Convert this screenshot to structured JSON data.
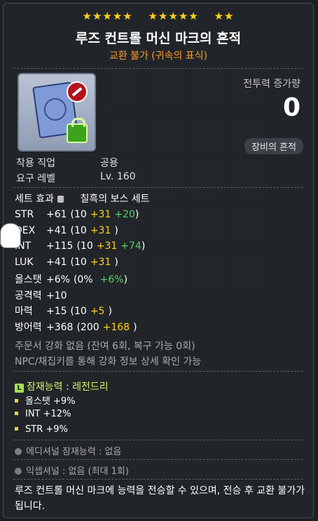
{
  "stars": {
    "group1": "★★★★★",
    "group2": "★★★★★",
    "group3": "★★"
  },
  "item": {
    "name": "루즈 컨트롤 머신 마크의 흔적",
    "trade": "교환 불가 (귀속의 표식)",
    "combat_power_label": "전투력 증가량",
    "combat_power_value": "0",
    "trace_button": "장비의 흔적"
  },
  "requirements": {
    "job_label": "착용 직업",
    "job_value": "공용",
    "level_label": "요구 레벨",
    "level_value": "Lv. 160"
  },
  "set_effect": {
    "label": "세트 효과",
    "value": "칠흑의 보스 세트"
  },
  "stats": [
    {
      "k": "STR",
      "total": "+61",
      "base": "(10",
      "plus1": "+31",
      "plus2": "+20",
      "close": ")"
    },
    {
      "k": "DEX",
      "total": "+41",
      "base": "(10",
      "plus1": "+31",
      "plus2": "",
      "close": ")"
    },
    {
      "k": "INT",
      "total": "+115",
      "base": "(10",
      "plus1": "+31",
      "plus2": "+74",
      "close": ")"
    },
    {
      "k": "LUK",
      "total": "+41",
      "base": "(10",
      "plus1": "+31",
      "plus2": "",
      "close": ")"
    },
    {
      "k": "올스탯",
      "total": "+6%",
      "base": "(0%",
      "plus1": "",
      "plus2": "+6%",
      "close": ")"
    },
    {
      "k": "공격력",
      "total": "+10",
      "base": "",
      "plus1": "",
      "plus2": "",
      "close": ""
    },
    {
      "k": "마력",
      "total": "+15",
      "base": "(10",
      "plus1": "+5",
      "plus2": "",
      "close": ")"
    },
    {
      "k": "방어력",
      "total": "+368",
      "base": "(200",
      "plus1": "+168",
      "plus2": "",
      "close": ")"
    }
  ],
  "scroll_info": "주문서 강화 없음 (잔여 6회, 복구 가능 0회)",
  "npc_info": "NPC/채집키를 통해 강화 정보 상세 확인 가능",
  "potential": {
    "badge": "L",
    "title": "잠재능력 : 레전드리",
    "lines": [
      "올스탯 +9%",
      "INT +12%",
      "STR +9%"
    ]
  },
  "additional_potential": "에디셔널 잠재능력 : 없음",
  "exceptional": "익셉셔널 : 없음 (최대 1회)",
  "description": "루즈 컨트롤 머신 마크에 능력을 전승할 수 있으며, 전승 후 교환 불가가 됩니다.",
  "colors": {
    "gold": "#ffd21c",
    "green": "#56d16d",
    "orange": "#ff9c2c",
    "legendary": "#a7e05a"
  }
}
